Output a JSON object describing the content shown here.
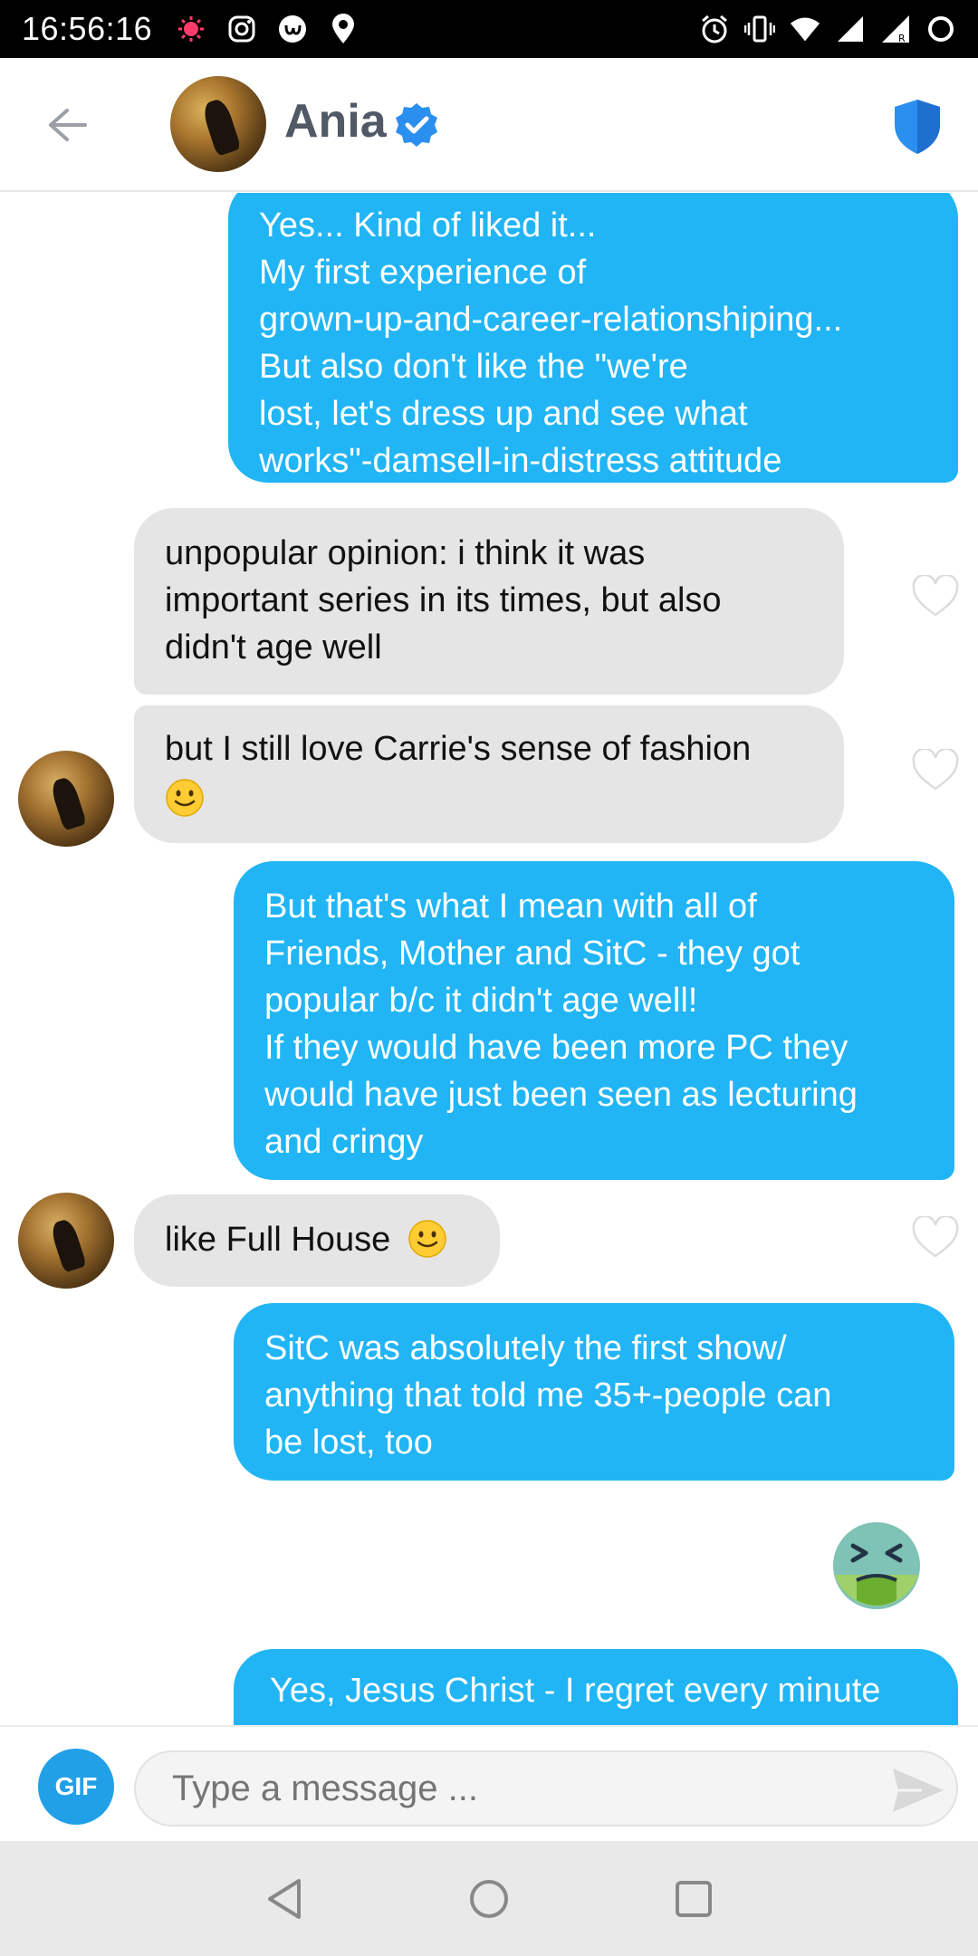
{
  "status_bar": {
    "time": "16:56:16"
  },
  "header": {
    "contact_name": "Ania"
  },
  "messages": [
    {
      "direction": "out",
      "lines": [
        "Yes... Kind of liked it...",
        "My first experience of",
        "grown-up-and-career-relationshiping...",
        "But also don't like the \"we're",
        "lost, let's dress up and see what",
        "works\"-damsell-in-distress attitude"
      ]
    },
    {
      "direction": "in",
      "lines": [
        "unpopular opinion: i think it was",
        "important series in its times, but also",
        "didn't age well"
      ]
    },
    {
      "direction": "in",
      "lines": [
        "but I still love Carrie's sense of fashion"
      ],
      "emoji": "slight-smile"
    },
    {
      "direction": "out",
      "lines": [
        "But that's what I mean with all of",
        "Friends, Mother and SitC - they got",
        "popular b/c it didn't age well!",
        "If they would have been more PC they",
        "would have just been seen as lecturing",
        "and cringy"
      ]
    },
    {
      "direction": "in",
      "lines": [
        "like Full House"
      ],
      "emoji": "slight-smile"
    },
    {
      "direction": "out",
      "lines": [
        "SitC was absolutely the first show/",
        "anything that told me 35+-people can",
        "be lost, too"
      ]
    },
    {
      "direction": "out",
      "emoji_only": "nauseated-face"
    },
    {
      "direction": "out",
      "lines": [
        "Yes, Jesus Christ - I regret every minute"
      ]
    }
  ],
  "composer": {
    "gif_label": "GIF",
    "placeholder": "Type a message ..."
  },
  "colors": {
    "outgoing_bubble": "#21b5f5",
    "incoming_bubble": "#e5e5e5",
    "accent": "#2b8ff0"
  }
}
